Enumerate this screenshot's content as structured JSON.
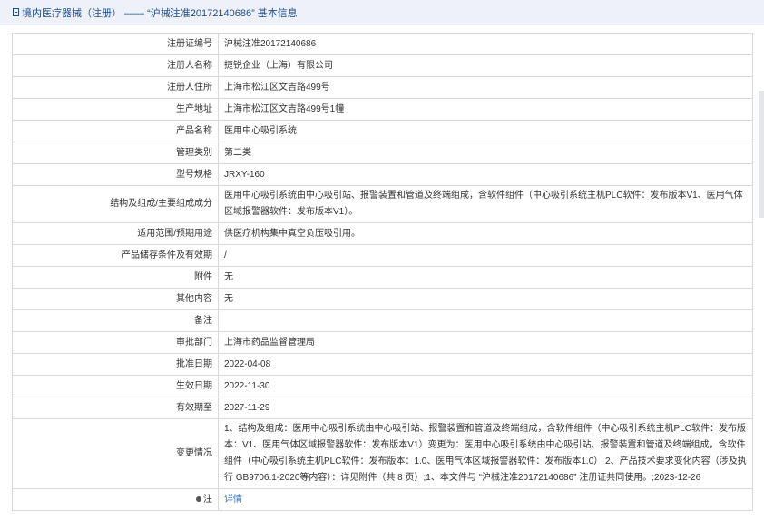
{
  "header": {
    "title": "境内医疗器械（注册） —— “沪械注准20172140686” 基本信息"
  },
  "rows": [
    {
      "label": "注册证编号",
      "value": "沪械注准20172140686"
    },
    {
      "label": "注册人名称",
      "value": "捷锐企业（上海）有限公司"
    },
    {
      "label": "注册人住所",
      "value": "上海市松江区文吉路499号"
    },
    {
      "label": "生产地址",
      "value": "上海市松江区文吉路499号1幢"
    },
    {
      "label": "产品名称",
      "value": "医用中心吸引系统"
    },
    {
      "label": "管理类别",
      "value": "第二类"
    },
    {
      "label": "型号规格",
      "value": "JRXY-160"
    },
    {
      "label": "结构及组成/主要组成成分",
      "value": "医用中心吸引系统由中心吸引站、报警装置和管道及终端组成，含软件组件（中心吸引系统主机PLC软件：发布版本V1、医用气体区域报警器软件：发布版本V1）。"
    },
    {
      "label": "适用范围/预期用途",
      "value": "供医疗机构集中真空负压吸引用。"
    },
    {
      "label": "产品储存条件及有效期",
      "value": "/"
    },
    {
      "label": "附件",
      "value": "无"
    },
    {
      "label": "其他内容",
      "value": "无"
    },
    {
      "label": "备注",
      "value": ""
    },
    {
      "label": "审批部门",
      "value": "上海市药品监督管理局"
    },
    {
      "label": "批准日期",
      "value": "2022-04-08"
    },
    {
      "label": "生效日期",
      "value": "2022-11-30"
    },
    {
      "label": "有效期至",
      "value": "2027-11-29"
    },
    {
      "label": "变更情况",
      "value": "1、结构及组成：医用中心吸引系统由中心吸引站、报警装置和管道及终端组成，含软件组件（中心吸引系统主机PLC软件：发布版本：V1、医用气体区域报警器软件：发布版本V1）变更为：医用中心吸引系统由中心吸引站、报警装置和管道及终端组成，含软件组件（中心吸引系统主机PLC软件：发布版本：1.0、医用气体区域报警器软件：发布版本1.0） 2、产品技术要求变化内容（涉及执行 GB9706.1-2020等内容）：详见附件（共 8 页）;1、本文件与 “沪械注准20172140686” 注册证共同使用。;2023-12-26"
    }
  ],
  "note": {
    "label": "注",
    "link": "详情"
  }
}
